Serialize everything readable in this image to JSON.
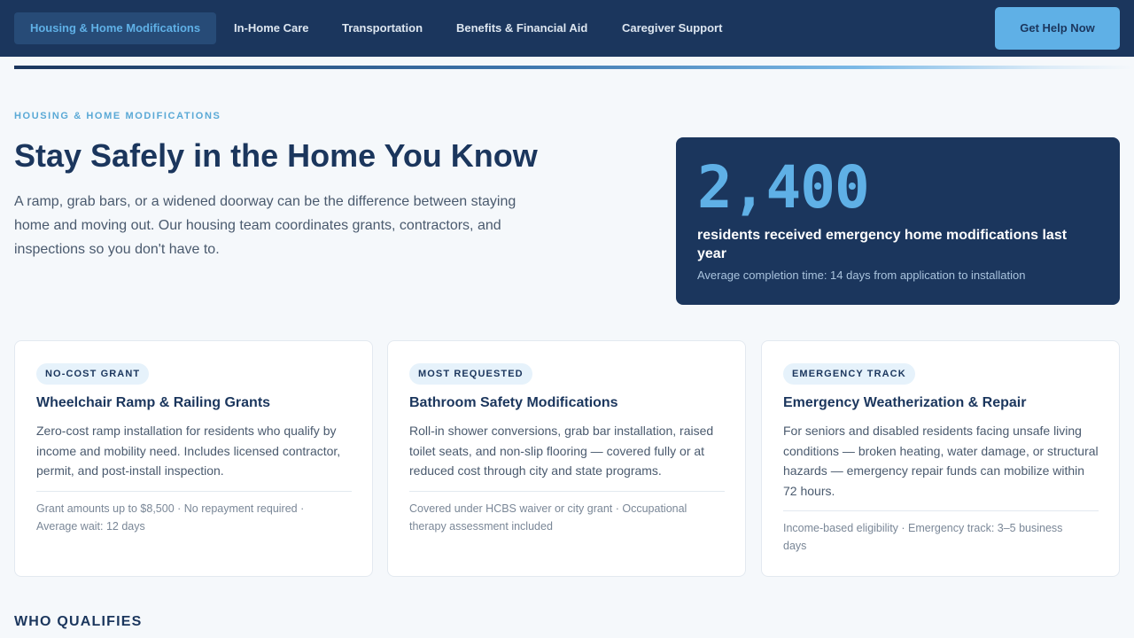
{
  "nav": {
    "tabs": [
      {
        "label": "Housing & Home Modifications",
        "active": true
      },
      {
        "label": "In-Home Care",
        "active": false
      },
      {
        "label": "Transportation",
        "active": false
      },
      {
        "label": "Benefits & Financial Aid",
        "active": false
      },
      {
        "label": "Caregiver Support",
        "active": false
      }
    ],
    "cta_label": "Get Help Now"
  },
  "hero": {
    "eyebrow": "HOUSING & HOME MODIFICATIONS",
    "title": "Stay Safely in the Home You Know",
    "body": "A ramp, grab bars, or a widened doorway can be the difference between staying home and moving out. Our housing team coordinates grants, contractors, and inspections so you don't have to."
  },
  "stat": {
    "number": "2,400",
    "label": "residents received emergency home modifications last year",
    "note": "Average completion time: 14 days from application to installation"
  },
  "cards": [
    {
      "badge": "NO-COST GRANT",
      "title": "Wheelchair Ramp & Railing Grants",
      "description": "Zero-cost ramp installation for residents who qualify by income and mobility need. Includes licensed contractor, permit, and post-install inspection.",
      "meta": "Grant amounts up to $8,500 · No repayment required · Average wait: 12 days"
    },
    {
      "badge": "MOST REQUESTED",
      "title": "Bathroom Safety Modifications",
      "description": "Roll-in shower conversions, grab bar installation, raised toilet seats, and non-slip flooring — covered fully or at reduced cost through city and state programs.",
      "meta": "Covered under HCBS waiver or city grant · Occupational therapy assessment included"
    },
    {
      "badge": "EMERGENCY TRACK",
      "title": "Emergency Weatherization & Repair",
      "description": "For seniors and disabled residents facing unsafe living conditions — broken heating, water damage, or structural hazards — emergency repair funds can mobilize within 72 hours.",
      "meta": "Income-based eligibility · Emergency track: 3–5 business days"
    }
  ],
  "section": {
    "heading": "WHO QUALIFIES"
  },
  "colors": {
    "navy": "#1b365d",
    "accent_blue": "#5fb0e6",
    "page_bg": "#f5f8fb",
    "badge_bg": "#e6f2fb"
  }
}
